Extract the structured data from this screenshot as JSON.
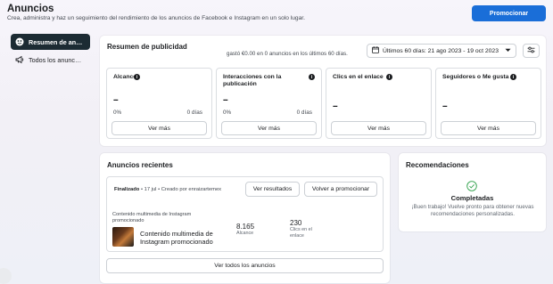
{
  "header": {
    "title": "Anuncios",
    "subtitle": "Crea, administra y haz un seguimiento del rendimiento de los anuncios de Facebook e Instagram en un solo lugar.",
    "promote_label": "Promocionar"
  },
  "sidebar": {
    "items": [
      {
        "label": "Resumen de an…",
        "icon": "summary-icon",
        "active": true
      },
      {
        "label": "Todos los anunc…",
        "icon": "megaphone-icon",
        "active": false
      }
    ]
  },
  "summary": {
    "title": "Resumen de publicidad",
    "note": "gastó €0.00 en 0 anuncios en los últimos 60 días.",
    "date_range": "Últimos 60 días: 21 ago 2023 - 19 oct 2023",
    "metrics": [
      {
        "title": "Alcance",
        "value": "--",
        "pct": "0%",
        "days": "0 días",
        "button": "Ver más",
        "info": true
      },
      {
        "title": "Interacciones con la publicación",
        "value": "--",
        "pct": "0%",
        "days": "0 días",
        "button": "Ver más",
        "info": true
      },
      {
        "title": "Clics en el enlace",
        "value": "--",
        "button": "Ver más",
        "info": true
      },
      {
        "title": "Seguidores o Me gusta",
        "value": "--",
        "button": "Ver más",
        "info": true
      }
    ]
  },
  "recent": {
    "title": "Anuncios recientes",
    "status": "Finalizado",
    "date": "17 jul",
    "creator": "Creado por enraizartemex",
    "view_results": "Ver resultados",
    "promote_again": "Volver a promocionar",
    "ad_type": "Contenido multimedia de Instagram promocionado",
    "ad_name": "Contenido multimedia de Instagram promocionado",
    "reach_value": "8.165",
    "reach_label": "Alcance",
    "clicks_value": "230",
    "clicks_label": "Clics en el enlace",
    "view_all": "Ver todos los anuncios"
  },
  "recommendations": {
    "title": "Recomendaciones",
    "status": "Completadas",
    "text": "¡Buen trabajo! Vuelve pronto para obtener nuevas recomendaciones personalizadas."
  },
  "colors": {
    "primary": "#1a6ed8",
    "sidebar_active": "#1c2b33",
    "success": "#31a24c"
  }
}
